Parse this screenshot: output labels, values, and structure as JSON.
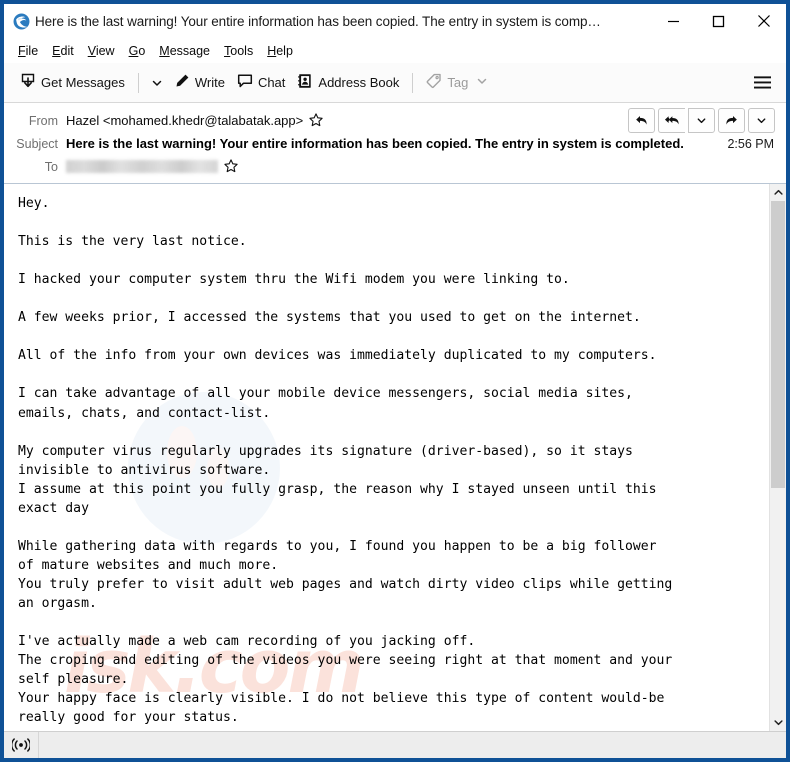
{
  "window": {
    "title": "Here is the last warning! Your entire information has been copied. The entry in system is comp…",
    "app_icon": "thunderbird-icon",
    "controls": {
      "minimize": "minimize-icon",
      "maximize": "maximize-icon",
      "close": "close-icon"
    },
    "accent_border": "#0f5196"
  },
  "menubar": {
    "items": [
      {
        "label": "File",
        "access": "F"
      },
      {
        "label": "Edit",
        "access": "E"
      },
      {
        "label": "View",
        "access": "V"
      },
      {
        "label": "Go",
        "access": "G"
      },
      {
        "label": "Message",
        "access": "M"
      },
      {
        "label": "Tools",
        "access": "T"
      },
      {
        "label": "Help",
        "access": "H"
      }
    ]
  },
  "toolbar": {
    "get_messages_label": "Get Messages",
    "write_label": "Write",
    "chat_label": "Chat",
    "address_book_label": "Address Book",
    "tag_label": "Tag",
    "tag_disabled": true,
    "app_menu": "hamburger-icon"
  },
  "message": {
    "from_label": "From",
    "from_value": "Hazel <mohamed.khedr@talabatak.app>",
    "subject_label": "Subject",
    "subject_value": "Here is the last warning! Your entire information has been copied. The entry in system is completed.",
    "time": "2:56 PM",
    "to_label": "To",
    "to_value": "",
    "to_redacted": true,
    "actions": {
      "reply": "reply-icon",
      "reply_all": "reply-all-icon",
      "reply_all_more": "chevron-down-icon",
      "forward": "forward-icon",
      "forward_more": "chevron-down-icon"
    },
    "body": "Hey.\n\nThis is the very last notice.\n\nI hacked your computer system thru the Wifi modem you were linking to.\n\nA few weeks prior, I accessed the systems that you used to get on the internet.\n\nAll of the info from your own devices was immediately duplicated to my computers.\n\nI can take advantage of all your mobile device messengers, social media sites,\nemails, chats, and contact-list.\n\nMy computer virus regularly upgrades its signature (driver-based), so it stays\ninvisible to antivirus software.\nI assume at this point you fully grasp, the reason why I stayed unseen until this\nexact day\n\nWhile gathering data with regards to you, I found you happen to be a big follower\nof mature websites and much more.\nYou truly prefer to visit adult web pages and watch dirty video clips while getting\nan orgasm.\n\nI've actually made a web cam recording of you jacking off.\nThe croping and editing of the videos you were seeing right at that moment and your\nself pleasure.\nYour happy face is clearly visible. I do not believe this type of content would-be\nreally good for your status.",
    "watermark_text": "isk.com"
  },
  "scrollbar": {
    "up": "chevron-up-icon",
    "down": "chevron-down-icon",
    "thumb_position": "top",
    "thumb_size_pct": 56
  },
  "statusbar": {
    "connection_icon": "broadcast-icon",
    "text": ""
  }
}
